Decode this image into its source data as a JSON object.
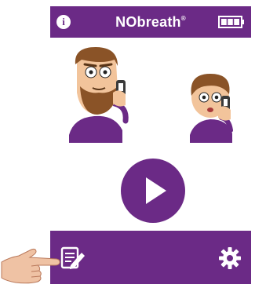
{
  "app": {
    "title": "NObreath",
    "title_mark": "®",
    "info_label": "i"
  },
  "status": {
    "battery_level": 1.0
  },
  "controls": {
    "play_icon": "play-icon",
    "notes_icon": "notes-edit-icon",
    "settings_icon": "gear-icon"
  },
  "colors": {
    "brand": "#6b2a86",
    "background": "#ffffff",
    "skin": "#f2c49b",
    "hair": "#8a5327"
  }
}
